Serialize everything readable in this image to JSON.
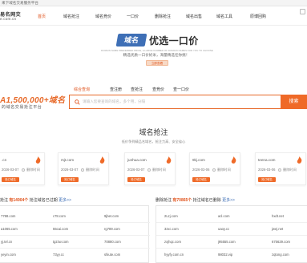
{
  "topbar": {
    "text": "来下域名交易服务平台"
  },
  "logo": {
    "title": "易名网交",
    "sub": "e.com.cn"
  },
  "nav": {
    "items": [
      "首页",
      "域名抢注",
      "域名竞价",
      "一口价",
      "删除抢注",
      "域名出售",
      "域名工具",
      "原博回购"
    ],
    "active_index": 0
  },
  "banner": {
    "badge": "域名",
    "title": "优选一口价",
    "en": "DOMAIN NAME PREFERRED PRICE, A LARGE NUMBER OF DOMAIN NAMES FOR YOU TO CHOOSE",
    "slogan": "精选优质一口价好米，海量精选任你挑！",
    "button": "立即查看"
  },
  "search": {
    "promo_big": "A1,500,000+域名",
    "promo_small": "的域名交易抢注平台",
    "tabs": [
      "综合查询",
      "查注册",
      "查抢注",
      "查竞价",
      "查一口价"
    ],
    "active_tab": 0,
    "placeholder": "请输入您要查询的域名，多个用，分隔",
    "button": "搜索"
  },
  "section": {
    "title": "域名抢注",
    "subtitle": "低价争到精品名域名，抢注力高、安全省心"
  },
  "cards": [
    {
      "domain": ".cn",
      "date": "2026-03-07",
      "status": "删除时间",
      "button": "抢订域名"
    },
    {
      "domain": "rsjt.com",
      "date": "2026-03-07",
      "status": "删除时间",
      "button": "抢订域名"
    },
    {
      "domain": "junhua.com",
      "date": "2026-03-07",
      "status": "删除时间",
      "button": "抢订域名"
    },
    {
      "domain": "9kj.com",
      "date": "2026-03-06",
      "status": "删除时间",
      "button": "抢订域名"
    },
    {
      "domain": "teena.com",
      "date": "2026-03-06",
      "status": "删除时间",
      "button": "抢订域名"
    }
  ],
  "lists": {
    "left": {
      "head_prefix": "抢注",
      "count_text": "有14904个",
      "head_suffix": "抢注域名已过期",
      "more": "更多>>",
      "rows": [
        [
          "7788.com",
          "c78.com",
          "9jbet.com"
        ],
        [
          "a1065.com",
          "55cai.com",
          "rg789.com"
        ],
        [
          "yj.tel.cn",
          "tgzzw.com",
          "70880.com"
        ],
        [
          "yeyin.com",
          "73yy.cc",
          "shiute.com"
        ]
      ]
    },
    "right": {
      "head_prefix": "删除抢注",
      "count_text": "有70865个",
      "head_suffix": "抢注域名已删除",
      "more": "更多>>",
      "rows": [
        [
          "2Lzj.com",
          "acl.com",
          "hxdt.net"
        ],
        [
          "3zxc.com",
          "uaoy.cc",
          "jwej.net"
        ],
        [
          "zxjhqc.com",
          "j95555.com",
          "675629.com"
        ],
        [
          "hyyfy.com.cn",
          "98032.vip",
          "zqtong.com"
        ]
      ]
    }
  },
  "colors": {
    "accent": "#ef6a28",
    "brand_blue": "#3e6fb6"
  }
}
